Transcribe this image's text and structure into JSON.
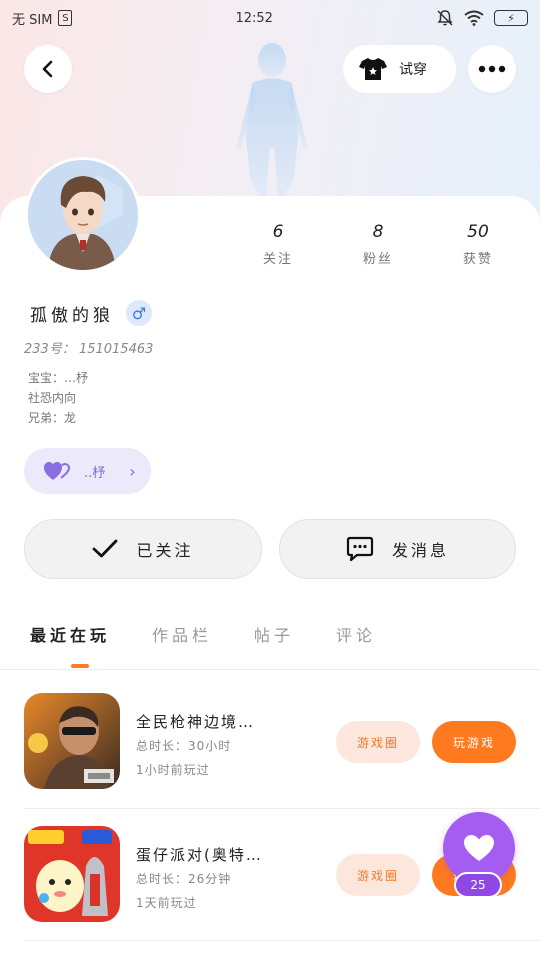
{
  "status_bar": {
    "sim_text": "无 SIM",
    "sim_card_icon": "S",
    "time": "12:52",
    "battery_text": "⚡"
  },
  "header": {
    "dress_label": "试穿"
  },
  "profile": {
    "stats": [
      {
        "value": "6",
        "label": "关注"
      },
      {
        "value": "8",
        "label": "粉丝"
      },
      {
        "value": "50",
        "label": "获赞"
      }
    ],
    "nickname": "孤傲的狼",
    "gender_symbol": "♂",
    "uid": "233号： 151015463",
    "bio_lines": [
      "宝宝：…杼",
      "社恐内向",
      "兄弟：龙"
    ],
    "badge_text": "..杼"
  },
  "actions": {
    "follow_label": "已关注",
    "message_label": "发消息"
  },
  "tabs": [
    {
      "label": "最近在玩",
      "active": true
    },
    {
      "label": "作品栏",
      "active": false
    },
    {
      "label": "帖子",
      "active": false
    },
    {
      "label": "评论",
      "active": false
    }
  ],
  "games": [
    {
      "title": "全民枪神边境…",
      "total_time": "总时长：30小时",
      "last_played": "1小时前玩过",
      "circle_label": "游戏圈",
      "play_label": "玩游戏"
    },
    {
      "title": "蛋仔派对(奥特…",
      "total_time": "总时长：26分钟",
      "last_played": "1天前玩过",
      "circle_label": "游戏圈",
      "play_label": "玩游戏"
    }
  ],
  "floating": {
    "like_count": "25"
  },
  "colors": {
    "accent_orange": "#ff7a1f",
    "like_purple": "#a55cf0",
    "badge_purple": "#7d6ad6"
  }
}
